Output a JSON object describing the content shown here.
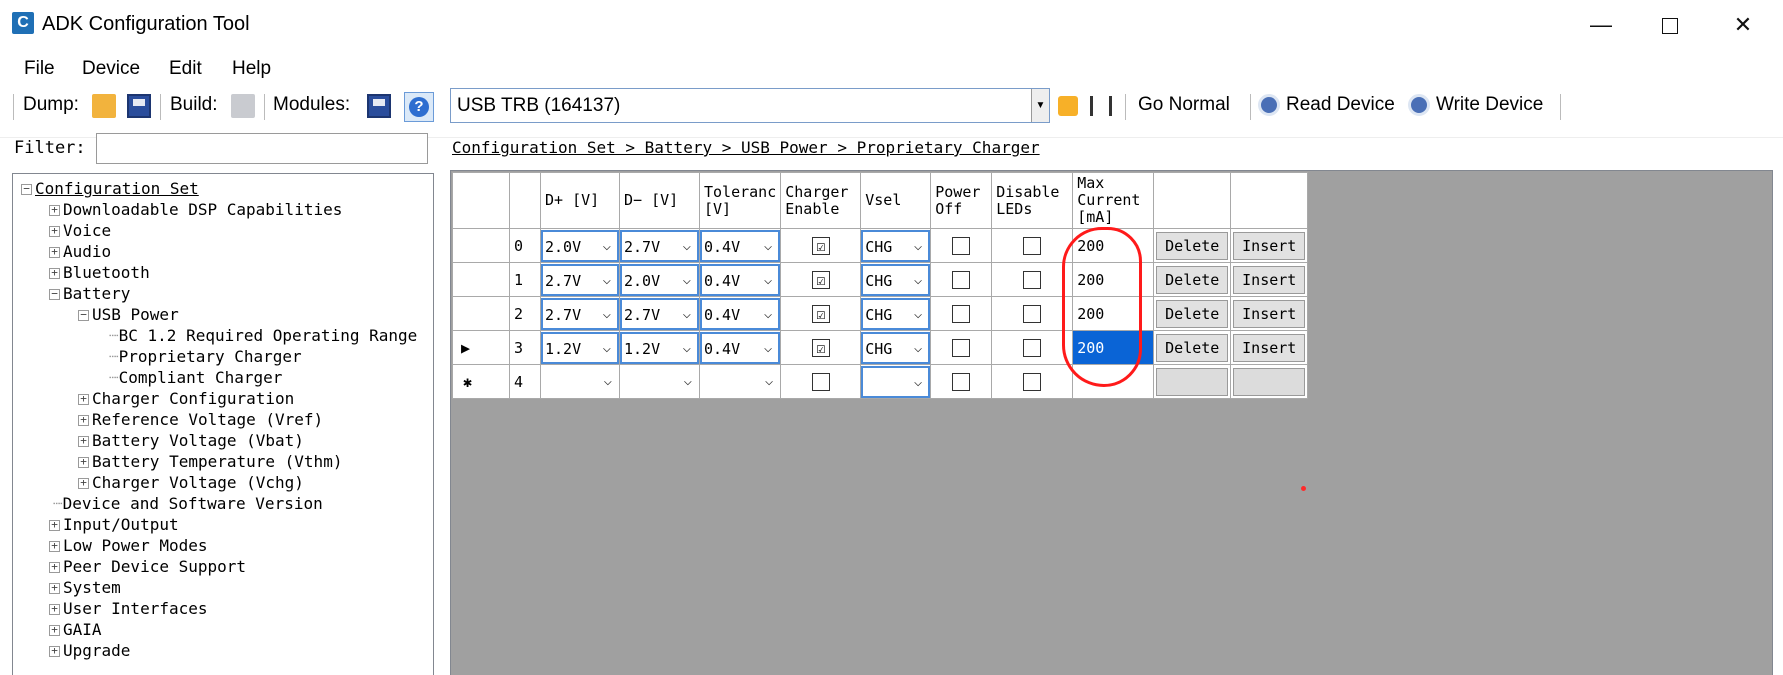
{
  "window": {
    "title": "ADK Configuration Tool"
  },
  "menu": [
    "File",
    "Device",
    "Edit",
    "Help"
  ],
  "toolbar": {
    "dump": "Dump:",
    "build": "Build:",
    "modules": "Modules:",
    "device": "USB TRB (164137)",
    "go_normal": "Go Normal",
    "read_device": "Read Device",
    "write_device": "Write Device"
  },
  "filter": {
    "label": "Filter:",
    "value": ""
  },
  "breadcrumb": "Configuration Set > Battery > USB Power > Proprietary Charger",
  "tree": [
    {
      "label": "Configuration Set",
      "exp": "−"
    },
    {
      "label": "Downloadable DSP Capabilities",
      "exp": "+"
    },
    {
      "label": "Voice",
      "exp": "+"
    },
    {
      "label": "Audio",
      "exp": "+"
    },
    {
      "label": "Bluetooth",
      "exp": "+"
    },
    {
      "label": "Battery",
      "exp": "−"
    },
    {
      "label": "USB Power",
      "exp": "−"
    },
    {
      "label": "BC 1.2 Required Operating Range",
      "exp": ""
    },
    {
      "label": "Proprietary Charger",
      "exp": ""
    },
    {
      "label": "Compliant Charger",
      "exp": ""
    },
    {
      "label": "Charger Configuration",
      "exp": "+"
    },
    {
      "label": "Reference Voltage (Vref)",
      "exp": "+"
    },
    {
      "label": "Battery Voltage (Vbat)",
      "exp": "+"
    },
    {
      "label": "Battery Temperature (Vthm)",
      "exp": "+"
    },
    {
      "label": "Charger Voltage (Vchg)",
      "exp": "+"
    },
    {
      "label": "Device and Software Version",
      "exp": ""
    },
    {
      "label": "Input/Output",
      "exp": "+"
    },
    {
      "label": "Low Power Modes",
      "exp": "+"
    },
    {
      "label": "Peer Device Support",
      "exp": "+"
    },
    {
      "label": "System",
      "exp": "+"
    },
    {
      "label": "User Interfaces",
      "exp": "+"
    },
    {
      "label": "GAIA",
      "exp": "+"
    },
    {
      "label": "Upgrade",
      "exp": "+"
    }
  ],
  "grid": {
    "headers": {
      "dplus": "D+ [V]",
      "dminus": "D− [V]",
      "tolerance": "Toleranc [V]",
      "charger_enable": "Charger Enable",
      "vsel": "Vsel",
      "power_off": "Power Off",
      "disable_leds": "Disable LEDs",
      "max_current": "Max Current [mA]"
    },
    "rows": [
      {
        "idx": "0",
        "dplus": "2.0V",
        "dminus": "2.7V",
        "tol": "0.4V",
        "charger_enable": "☑",
        "vsel": "CHG",
        "power_off": "",
        "disable_leds": "",
        "max_current": "200",
        "delete": "Delete",
        "insert": "Insert"
      },
      {
        "idx": "1",
        "dplus": "2.7V",
        "dminus": "2.0V",
        "tol": "0.4V",
        "charger_enable": "☑",
        "vsel": "CHG",
        "power_off": "",
        "disable_leds": "",
        "max_current": "200",
        "delete": "Delete",
        "insert": "Insert"
      },
      {
        "idx": "2",
        "dplus": "2.7V",
        "dminus": "2.7V",
        "tol": "0.4V",
        "charger_enable": "☑",
        "vsel": "CHG",
        "power_off": "",
        "disable_leds": "",
        "max_current": "200",
        "delete": "Delete",
        "insert": "Insert"
      },
      {
        "idx": "3",
        "dplus": "1.2V",
        "dminus": "1.2V",
        "tol": "0.4V",
        "charger_enable": "☑",
        "vsel": "CHG",
        "power_off": "",
        "disable_leds": "",
        "max_current": "200",
        "delete": "Delete",
        "insert": "Insert"
      },
      {
        "idx": "4",
        "dplus": "",
        "dminus": "",
        "tol": "",
        "charger_enable": "",
        "vsel": "",
        "power_off": "",
        "disable_leds": "",
        "max_current": "",
        "delete": "",
        "insert": ""
      }
    ],
    "current_row_marker": "▶",
    "new_row_marker": "✱"
  },
  "colors": {
    "selection": "#0a64d6",
    "annotation": "#ff1a1a",
    "grid_background": "#a0a0a0"
  },
  "icons": [
    "app-icon",
    "folder-icon",
    "save-icon",
    "help-icon",
    "refresh-icon",
    "mode-icon",
    "read-device-icon",
    "write-device-icon",
    "minimize-icon",
    "maximize-icon",
    "close-icon"
  ]
}
